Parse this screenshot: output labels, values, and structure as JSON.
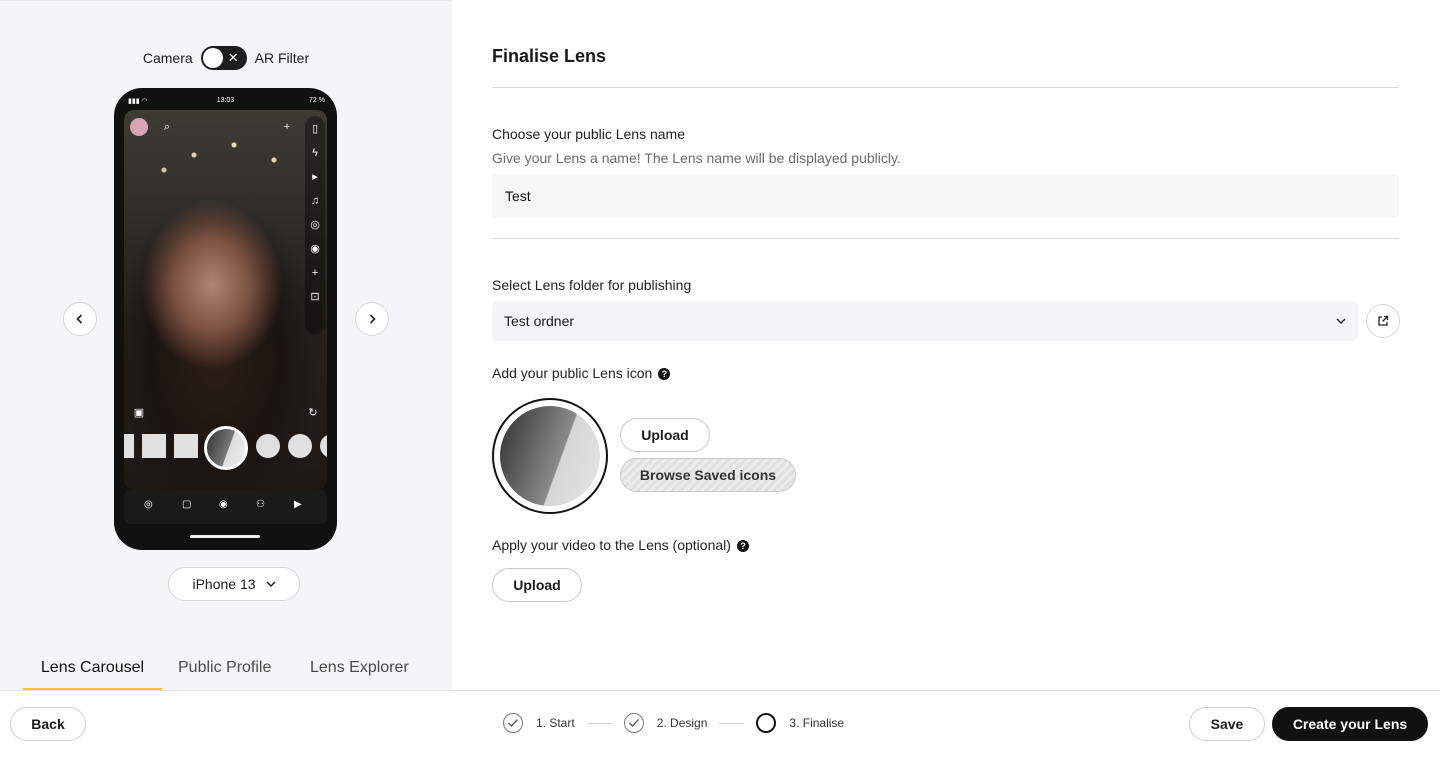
{
  "preview": {
    "toggle_left": "Camera",
    "toggle_right": "AR Filter",
    "toggle_x": "✕",
    "status_time": "13:03",
    "status_battery": "72 %",
    "device": "iPhone 13"
  },
  "tabs": [
    {
      "label": "Lens Carousel",
      "active": true
    },
    {
      "label": "Public Profile",
      "active": false
    },
    {
      "label": "Lens Explorer",
      "active": false
    }
  ],
  "form": {
    "title": "Finalise Lens",
    "name_label": "Choose your public Lens name",
    "name_help": "Give your Lens a name! The Lens name will be displayed publicly.",
    "name_value": "Test",
    "folder_label": "Select Lens folder for publishing",
    "folder_value": "Test ordner",
    "icon_label": "Add your public Lens icon",
    "icon_upload": "Upload",
    "icon_browse": "Browse Saved icons",
    "video_label": "Apply your video to the Lens (optional)",
    "video_upload": "Upload"
  },
  "footer": {
    "back": "Back",
    "save": "Save",
    "create": "Create your Lens",
    "steps": [
      {
        "label": "1. Start",
        "done": true
      },
      {
        "label": "2. Design",
        "done": true
      },
      {
        "label": "3. Finalise",
        "done": false
      }
    ]
  },
  "icons": {
    "prev": "chevron-left-icon",
    "next": "chevron-right-icon",
    "dropdown": "chevron-down-icon",
    "external": "external-link-icon",
    "help": "question-circle-icon",
    "check": "check-icon"
  },
  "colors": {
    "accent": "#f5c518",
    "primary_button": "#111111",
    "left_panel_bg": "#f4f5f7"
  }
}
